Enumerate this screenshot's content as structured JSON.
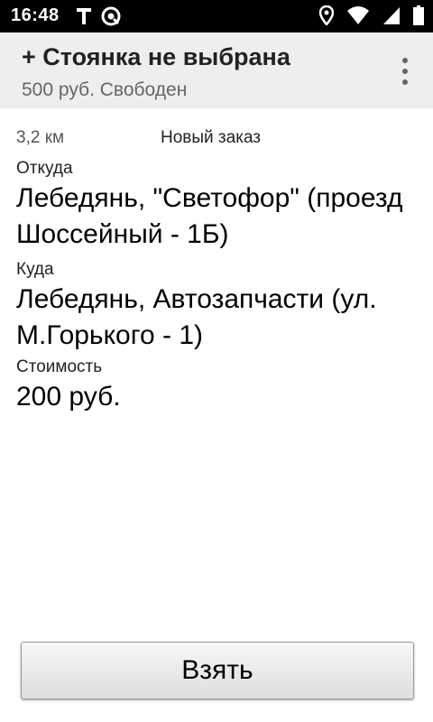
{
  "status_bar": {
    "time": "16:48",
    "left_icons": [
      "t-icon",
      "at-sign-icon"
    ],
    "right_icons": [
      "location-icon",
      "wifi-icon",
      "signal-icon",
      "battery-icon"
    ]
  },
  "app_bar": {
    "title": "+ Стоянка не выбрана",
    "subtitle": "500 руб. Свободен",
    "menu_icon": "more-vert-icon"
  },
  "order": {
    "distance": "3,2 км",
    "status": "Новый заказ",
    "from_label": "Откуда",
    "from_value": "Лебедянь, \"Светофор\" (проезд Шоссейный - 1Б)",
    "to_label": "Куда",
    "to_value": "Лебедянь, Автозапчасти (ул. М.Горького - 1)",
    "price_label": "Стоимость",
    "price_value": "200 руб."
  },
  "actions": {
    "take_label": "Взять"
  },
  "colors": {
    "status_bar_bg": "#000000",
    "app_bar_bg": "#eeeeee",
    "subtitle": "#666666"
  }
}
